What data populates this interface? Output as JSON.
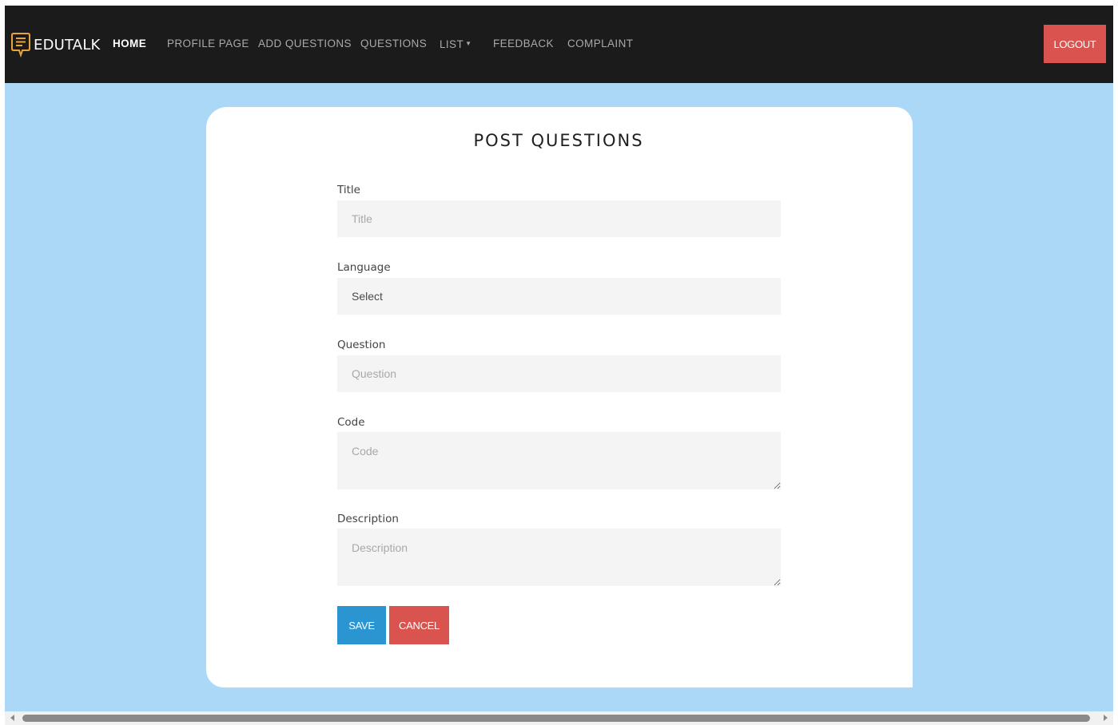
{
  "navbar": {
    "brand": {
      "icon": "chat-document-icon",
      "name": "EDUTALK"
    },
    "links": {
      "home": "HOME",
      "profile": "PROFILE PAGE",
      "add_questions": "ADD QUESTIONS",
      "questions": "QUESTIONS",
      "list": "LIST",
      "feedback": "FEEDBACK",
      "complaint": "COMPLAINT"
    },
    "logout": "LOGOUT"
  },
  "form": {
    "title": "POST QUESTIONS",
    "fields": {
      "title": {
        "label": "Title",
        "placeholder": "Title"
      },
      "language": {
        "label": "Language",
        "value": "Select"
      },
      "question": {
        "label": "Question",
        "placeholder": "Question"
      },
      "code": {
        "label": "Code",
        "placeholder": "Code"
      },
      "description": {
        "label": "Description",
        "placeholder": "Description"
      }
    },
    "buttons": {
      "save": "SAVE",
      "cancel": "CANCEL"
    }
  },
  "colors": {
    "navbar_bg": "#1b1b1b",
    "page_bg": "#acd8f7",
    "brand_icon": "#e8a33d",
    "save": "#2a95d0",
    "danger": "#d9534f"
  }
}
